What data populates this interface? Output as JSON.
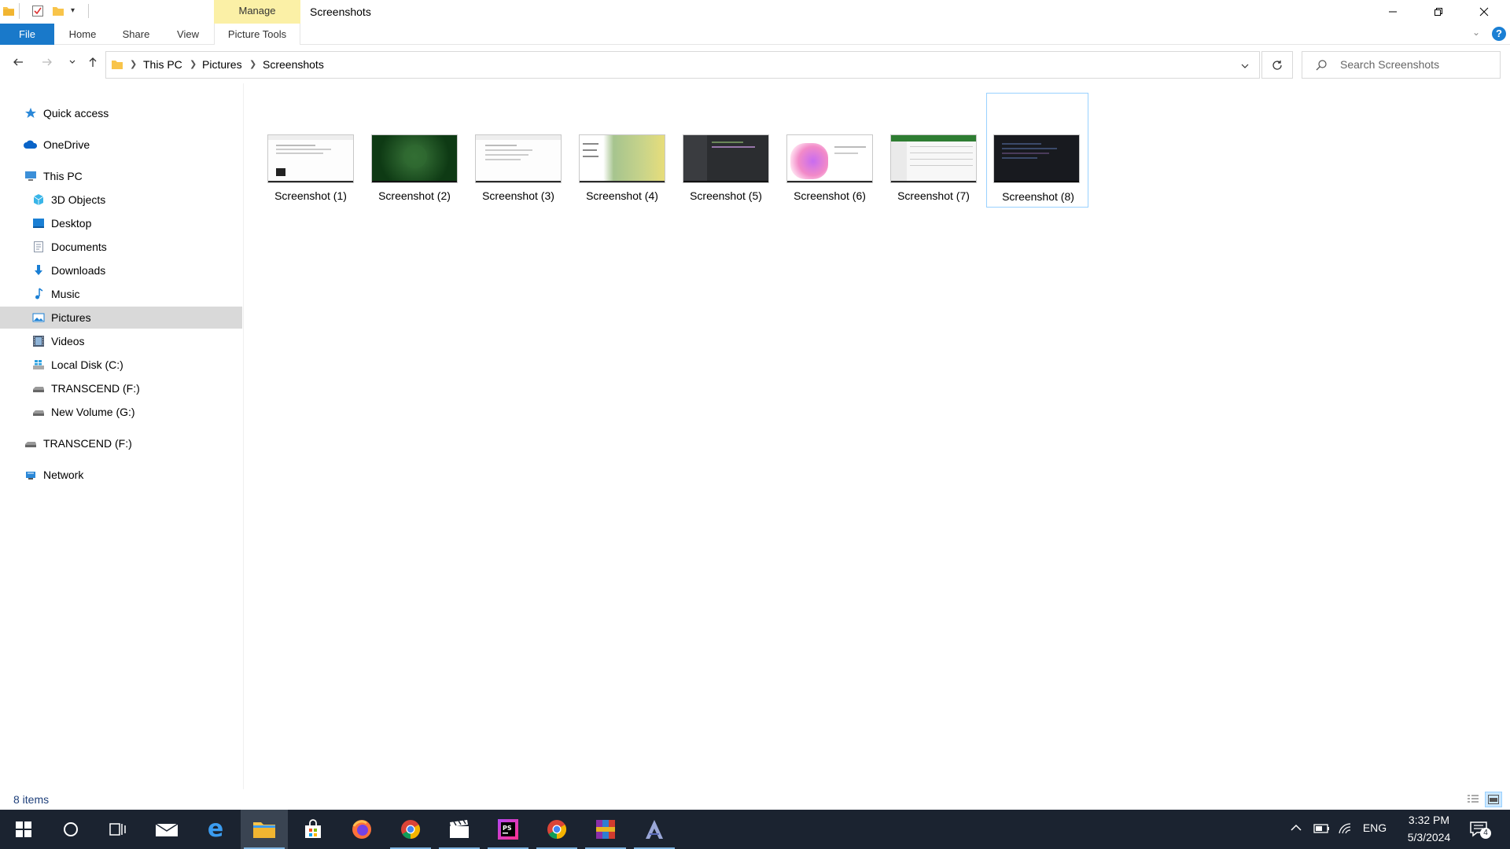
{
  "window": {
    "title": "Screenshots",
    "context_tab_group": "Manage",
    "context_tab": "Picture Tools"
  },
  "ribbon": {
    "tabs": [
      {
        "label": "File"
      },
      {
        "label": "Home"
      },
      {
        "label": "Share"
      },
      {
        "label": "View"
      }
    ]
  },
  "address": {
    "breadcrumbs": [
      "This PC",
      "Pictures",
      "Screenshots"
    ],
    "search_placeholder": "Search Screenshots"
  },
  "navpane": {
    "items": [
      {
        "label": "Quick access",
        "icon": "star-icon",
        "color": "#2b88d8"
      },
      {
        "label": "OneDrive",
        "icon": "cloud-icon",
        "color": "#0a64c8"
      },
      {
        "label": "This PC",
        "icon": "computer-icon",
        "color": "#3b8fd8"
      },
      {
        "label": "3D Objects",
        "icon": "cube-icon",
        "color": "#38b5e8"
      },
      {
        "label": "Desktop",
        "icon": "desktop-icon",
        "color": "#1a7fd4"
      },
      {
        "label": "Documents",
        "icon": "document-icon",
        "color": "#8a96a8"
      },
      {
        "label": "Downloads",
        "icon": "download-icon",
        "color": "#1a7fd4"
      },
      {
        "label": "Music",
        "icon": "music-icon",
        "color": "#1a7fd4"
      },
      {
        "label": "Pictures",
        "icon": "pictures-icon",
        "color": "#1a7fd4"
      },
      {
        "label": "Videos",
        "icon": "film-icon",
        "color": "#4a5a70"
      },
      {
        "label": "Local Disk (C:)",
        "icon": "windows-drive-icon",
        "color": "#2aa0e0"
      },
      {
        "label": "TRANSCEND (F:)",
        "icon": "drive-icon",
        "color": "#777777"
      },
      {
        "label": "New Volume (G:)",
        "icon": "drive-icon",
        "color": "#777777"
      },
      {
        "label": "TRANSCEND (F:)",
        "icon": "drive-icon",
        "color": "#777777"
      },
      {
        "label": "Network",
        "icon": "network-icon",
        "color": "#2b88d8"
      }
    ]
  },
  "files": [
    {
      "name": "Screenshot (1)",
      "style": "light-doc"
    },
    {
      "name": "Screenshot (2)",
      "style": "green"
    },
    {
      "name": "Screenshot (3)",
      "style": "light-doc"
    },
    {
      "name": "Screenshot (4)",
      "style": "blurred"
    },
    {
      "name": "Screenshot (5)",
      "style": "dark-ide"
    },
    {
      "name": "Screenshot (6)",
      "style": "gradient"
    },
    {
      "name": "Screenshot (7)",
      "style": "spreadsheet"
    },
    {
      "name": "Screenshot (8)",
      "style": "dark-code"
    }
  ],
  "status": {
    "item_count": "8 items"
  },
  "taskbar": {
    "apps": [
      "start-icon",
      "search-circle-icon",
      "task-view-icon",
      "mail-icon",
      "edge-icon",
      "file-explorer-icon",
      "store-icon",
      "firefox-icon",
      "chrome-icon",
      "clapper-icon",
      "phpstorm-icon",
      "chrome-icon",
      "winrar-icon",
      "app-a-icon"
    ],
    "language": "ENG",
    "time": "3:32 PM",
    "date": "5/3/2024",
    "notification_count": "4"
  }
}
